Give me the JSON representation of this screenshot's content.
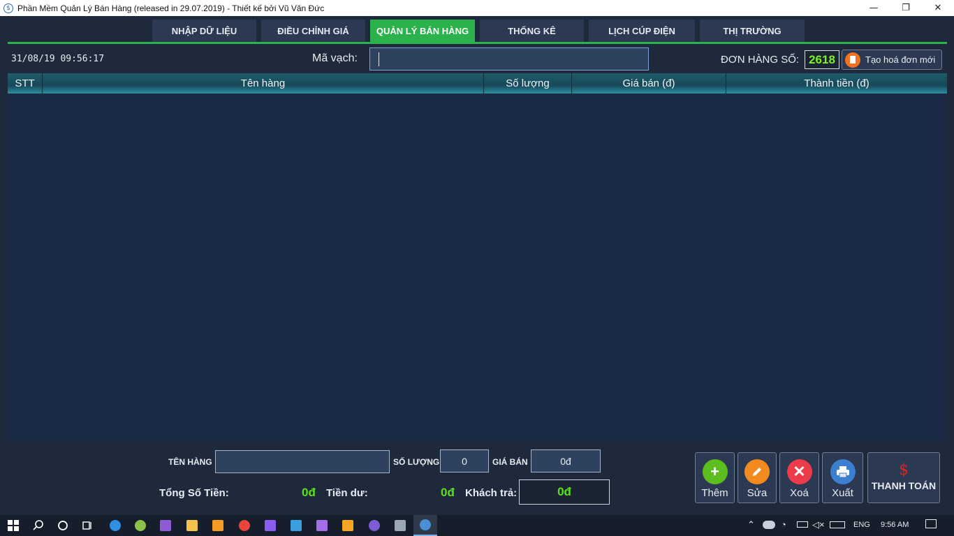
{
  "window": {
    "title": "Phần Mềm Quản Lý Bán Hàng (released in 29.07.2019) - Thiết kế bởi Vũ Văn Đức",
    "minimize_glyph": "—",
    "restore_glyph": "❐",
    "close_glyph": "✕"
  },
  "tabs": [
    {
      "label": "NHẬP DỮ LIỆU"
    },
    {
      "label": "ĐIỀU CHỈNH GIÁ"
    },
    {
      "label": "QUẢN LÝ BÁN HÀNG",
      "active": true
    },
    {
      "label": "THỐNG KÊ"
    },
    {
      "label": "LỊCH CÚP ĐIỆN"
    },
    {
      "label": "THỊ TRƯỜNG"
    }
  ],
  "header": {
    "datetime": "31/08/19 09:56:17",
    "barcode_label": "Mã vạch:",
    "barcode_value": "",
    "order_label": "ĐƠN HÀNG SỐ:",
    "order_number": "2618",
    "new_invoice_label": "Tạo hoá đơn mới"
  },
  "table": {
    "columns": [
      "STT",
      "Tên hàng",
      "Số lượng",
      "Giá bán (đ)",
      "Thành tiền (đ)"
    ],
    "rows": []
  },
  "entry": {
    "name_label": "TÊN HÀNG",
    "name_value": "",
    "qty_label": "SỐ LƯỢNG",
    "qty_value": "0",
    "price_label": "GIÁ BÁN",
    "price_value": "0đ"
  },
  "totals": {
    "total_label": "Tổng Số Tiền:",
    "total_value": "0đ",
    "change_label": "Tiền dư:",
    "change_value": "0đ",
    "paid_label": "Khách trả:",
    "paid_value": "0đ"
  },
  "actions": {
    "add": "Thêm",
    "edit": "Sửa",
    "delete": "Xoá",
    "export": "Xuất",
    "pay": "THANH TOÁN",
    "pay_symbol": "$"
  },
  "taskbar": {
    "language": "ENG",
    "time": "9:56 AM"
  },
  "colors": {
    "accent_green": "#2bb24c",
    "money_green": "#5be11b",
    "order_green": "#7cf023",
    "background": "#1e2a3c"
  }
}
